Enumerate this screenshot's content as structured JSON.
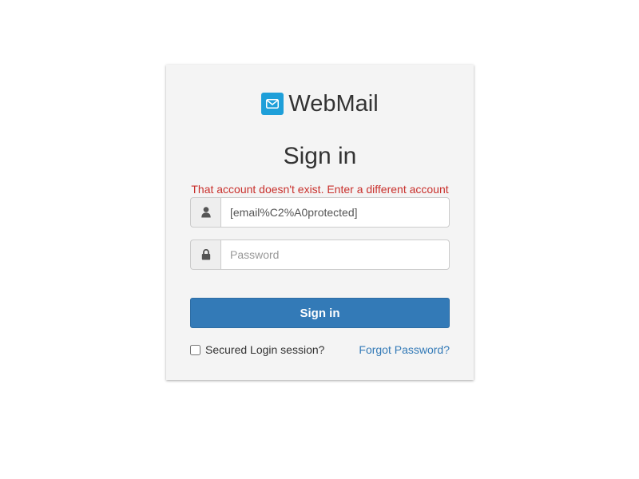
{
  "brand": {
    "name": "WebMail",
    "icon": "envelope-icon",
    "color": "#1e9fd9"
  },
  "form": {
    "heading": "Sign in",
    "error_message": "That account doesn't exist. Enter a different account",
    "username": {
      "value": "[email%C2%A0protected]",
      "icon": "user-icon"
    },
    "password": {
      "value": "",
      "placeholder": "Password",
      "icon": "lock-icon"
    },
    "submit_label": "Sign in",
    "secured_login_label": "Secured Login session?",
    "secured_login_checked": false,
    "forgot_password_label": "Forgot Password?"
  },
  "colors": {
    "primary": "#337ab7",
    "error": "#c9302c"
  }
}
